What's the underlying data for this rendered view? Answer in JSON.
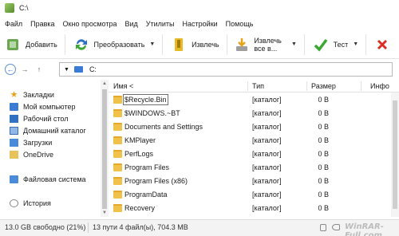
{
  "window": {
    "title": "C:\\"
  },
  "menu": [
    "Файл",
    "Правка",
    "Окно просмотра",
    "Вид",
    "Утилиты",
    "Настройки",
    "Помощь"
  ],
  "toolbar": {
    "add_label": "Добавить",
    "convert_label": "Преобразовать",
    "extract_label": "Извлечь",
    "extract_all_label": "Извлечь все в...",
    "test_label": "Тест"
  },
  "address": {
    "path": "C:"
  },
  "sidebar": {
    "bookmarks_label": "Закладки",
    "items": [
      "Мой компьютер",
      "Рабочий стол",
      "Домашний каталог",
      "Загрузки",
      "OneDrive"
    ],
    "filesystem_label": "Файловая система",
    "history_label": "История"
  },
  "columns": {
    "name": "Имя <",
    "type": "Тип",
    "size": "Размер",
    "info": "Инфо"
  },
  "files": [
    {
      "name": "$Recycle.Bin",
      "type": "[каталог]",
      "size": "0 B"
    },
    {
      "name": "$WINDOWS.~BT",
      "type": "[каталог]",
      "size": "0 B"
    },
    {
      "name": "Documents and Settings",
      "type": "[каталог]",
      "size": "0 B"
    },
    {
      "name": "KMPlayer",
      "type": "[каталог]",
      "size": "0 B"
    },
    {
      "name": "PerfLogs",
      "type": "[каталог]",
      "size": "0 B"
    },
    {
      "name": "Program Files",
      "type": "[каталог]",
      "size": "0 B"
    },
    {
      "name": "Program Files (x86)",
      "type": "[каталог]",
      "size": "0 B"
    },
    {
      "name": "ProgramData",
      "type": "[каталог]",
      "size": "0 B"
    },
    {
      "name": "Recovery",
      "type": "[каталог]",
      "size": "0 B"
    }
  ],
  "status": {
    "free": "13.0 GB свободно (21%)",
    "summary": "13 пути 4 файл(ы), 704.3 MB",
    "watermark": "WinRAR-Full.com"
  },
  "colors": {
    "folder": "#f0c24b",
    "accent": "#3a7bd5",
    "check": "#3aa832"
  }
}
